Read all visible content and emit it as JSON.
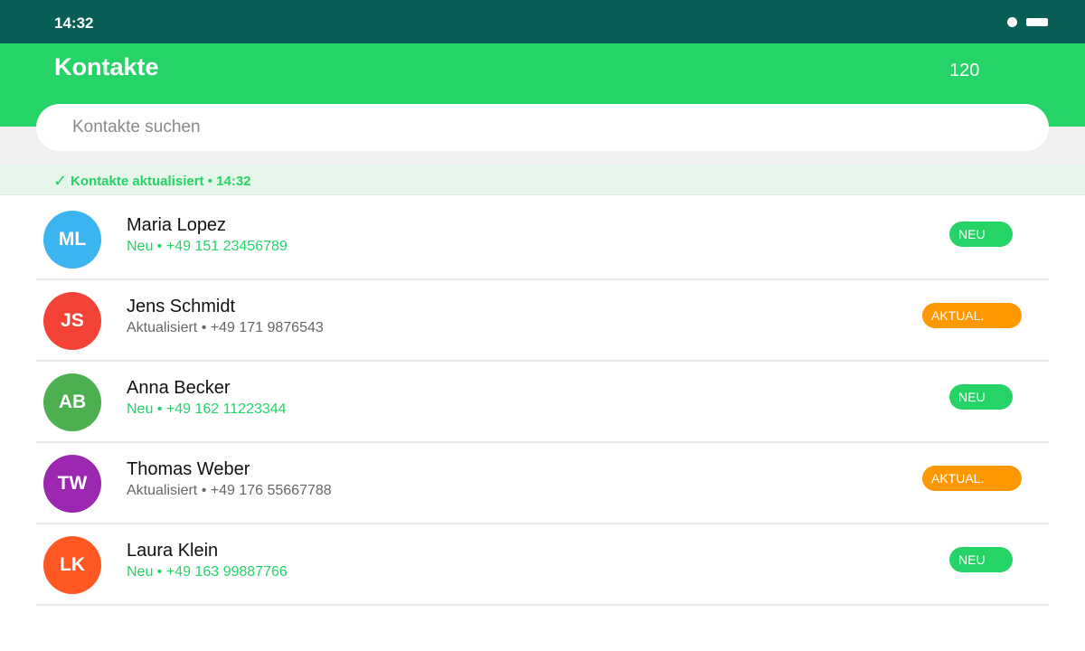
{
  "status_bar": {
    "time": "14:32"
  },
  "header": {
    "title": "Kontakte",
    "count": "120"
  },
  "search": {
    "placeholder": "Kontakte suchen",
    "value": ""
  },
  "sync_banner": {
    "check": "✓",
    "text": "Kontakte aktualisiert • 14:32"
  },
  "colors": {
    "status_bar": "#075e54",
    "accent": "#25d366",
    "new_badge": "#25d366",
    "updated_badge": "#ff9800",
    "updated_text": "#666666"
  },
  "contacts": [
    {
      "initials": "ML",
      "name": "Maria Lopez",
      "detail": "Neu • +49 151 23456789",
      "badge": "NEU",
      "state": "new",
      "avatar_color": "#3cb4f0"
    },
    {
      "initials": "JS",
      "name": "Jens Schmidt",
      "detail": "Aktualisiert • +49 171 9876543",
      "badge": "AKTUAL.",
      "state": "updated",
      "avatar_color": "#f44336"
    },
    {
      "initials": "AB",
      "name": "Anna Becker",
      "detail": "Neu • +49 162 11223344",
      "badge": "NEU",
      "state": "new",
      "avatar_color": "#4caf50"
    },
    {
      "initials": "TW",
      "name": "Thomas Weber",
      "detail": "Aktualisiert • +49 176 55667788",
      "badge": "AKTUAL.",
      "state": "updated",
      "avatar_color": "#9c27b0"
    },
    {
      "initials": "LK",
      "name": "Laura Klein",
      "detail": "Neu • +49 163 99887766",
      "badge": "NEU",
      "state": "new",
      "avatar_color": "#ff5722"
    }
  ]
}
